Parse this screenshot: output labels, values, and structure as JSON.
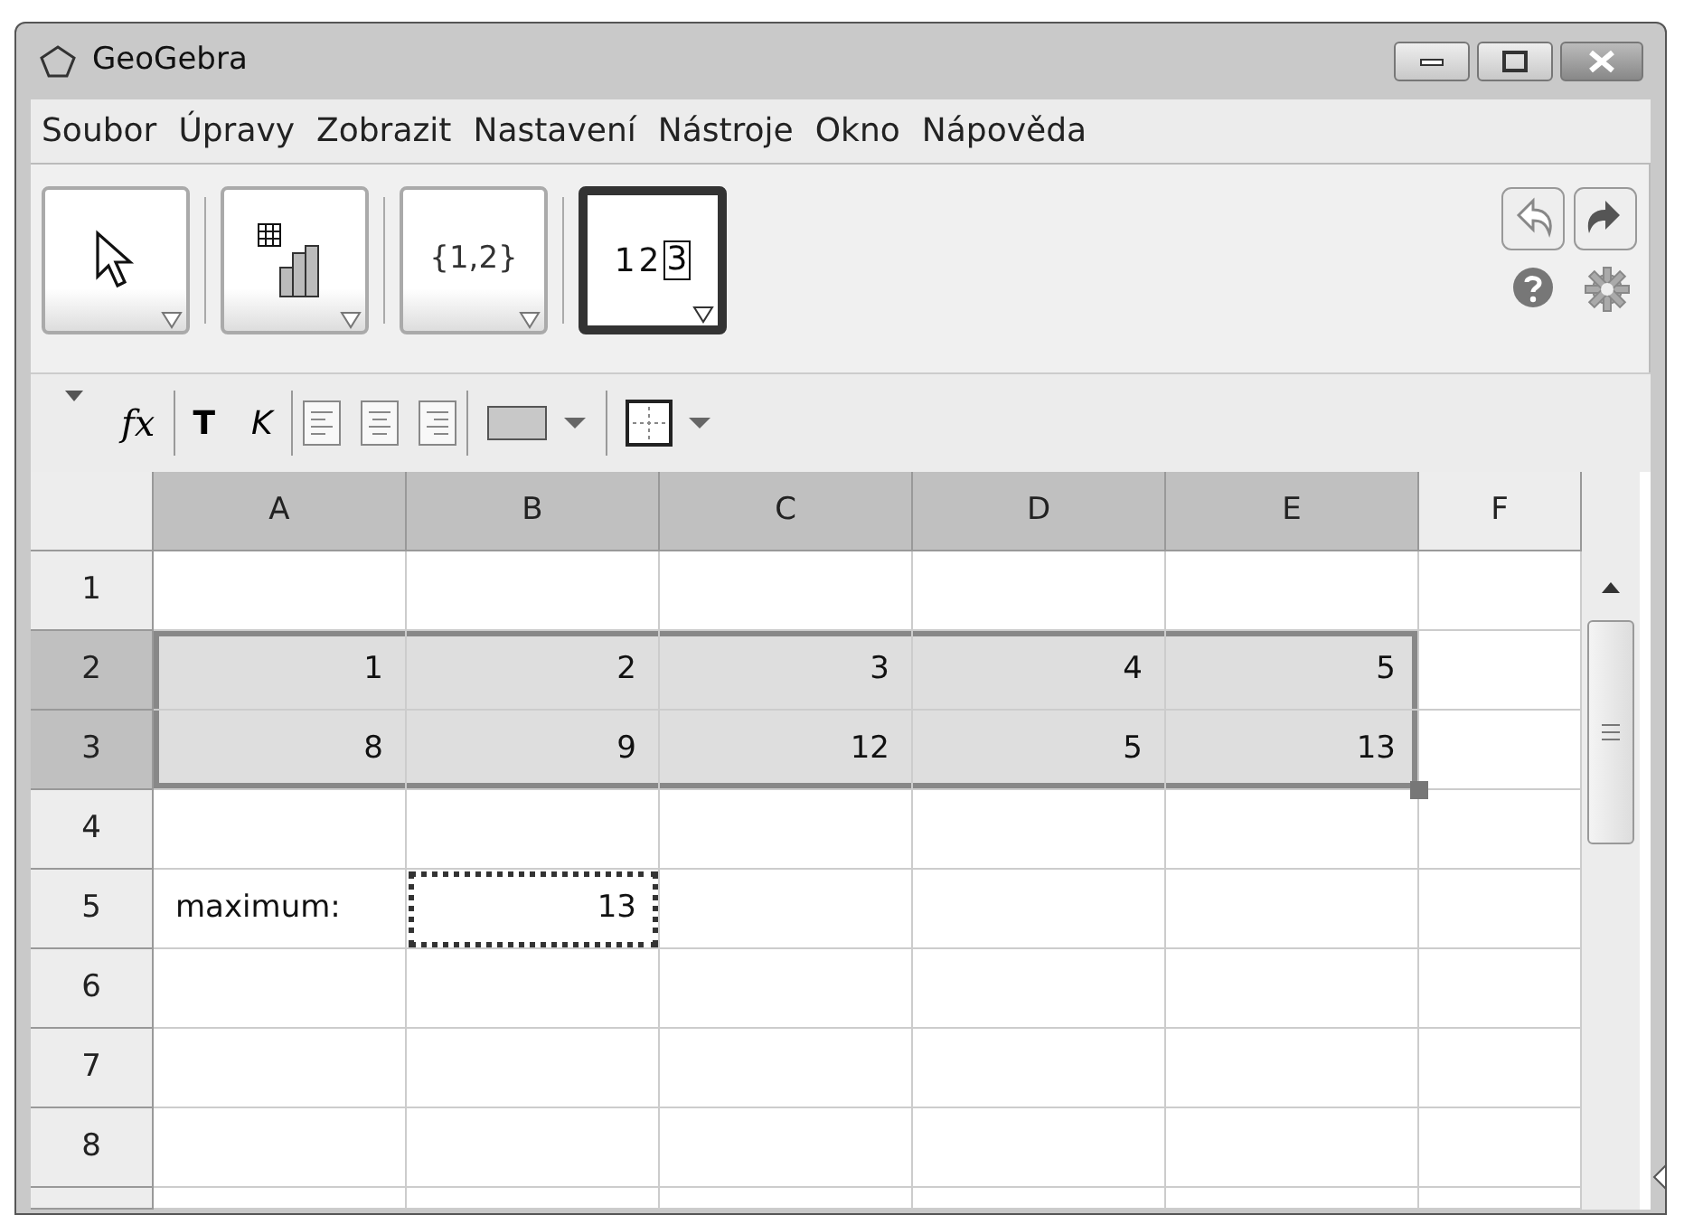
{
  "window": {
    "title": "GeoGebra"
  },
  "menu": [
    "Soubor",
    "Úpravy",
    "Zobrazit",
    "Nastavení",
    "Nástroje",
    "Okno",
    "Nápověda"
  ],
  "tools": [
    {
      "kind": "move",
      "selected": false
    },
    {
      "kind": "chart",
      "selected": false
    },
    {
      "kind": "list",
      "label": "{1,2}",
      "selected": false
    },
    {
      "kind": "table",
      "label": "12",
      "boxed_label": "3",
      "selected": true
    }
  ],
  "format_bar": [
    {
      "kind": "collapse"
    },
    {
      "kind": "formula",
      "label": "fx"
    },
    {
      "kind": "separator"
    },
    {
      "kind": "bold",
      "label": "T"
    },
    {
      "kind": "italic",
      "label": "K"
    },
    {
      "kind": "separator"
    },
    {
      "kind": "align-left"
    },
    {
      "kind": "align-center"
    },
    {
      "kind": "align-right"
    },
    {
      "kind": "separator"
    },
    {
      "kind": "fill"
    },
    {
      "kind": "separator"
    },
    {
      "kind": "border"
    }
  ],
  "columns": [
    {
      "label": "A",
      "selected": true
    },
    {
      "label": "B",
      "selected": true
    },
    {
      "label": "C",
      "selected": true
    },
    {
      "label": "D",
      "selected": true
    },
    {
      "label": "E",
      "selected": true
    },
    {
      "label": "F",
      "selected": false
    }
  ],
  "rows": [
    {
      "label": "1",
      "selected": false,
      "cells": [
        {
          "selected": false
        },
        {
          "selected": false
        },
        {
          "selected": false
        },
        {
          "selected": false
        },
        {
          "selected": false
        },
        {
          "selected": false
        }
      ]
    },
    {
      "label": "2",
      "selected": true,
      "cells": [
        {
          "text": "1",
          "selected": true
        },
        {
          "text": "2",
          "selected": true
        },
        {
          "text": "3",
          "selected": true
        },
        {
          "text": "4",
          "selected": true
        },
        {
          "text": "5",
          "selected": true
        },
        {
          "selected": false
        }
      ]
    },
    {
      "label": "3",
      "selected": true,
      "cells": [
        {
          "text": "8",
          "selected": true
        },
        {
          "text": "9",
          "selected": true
        },
        {
          "text": "12",
          "selected": true
        },
        {
          "text": "5",
          "selected": true
        },
        {
          "text": "13",
          "selected": true
        },
        {
          "selected": false
        }
      ]
    },
    {
      "label": "4",
      "selected": false,
      "cells": [
        {
          "selected": false
        },
        {
          "selected": false
        },
        {
          "selected": false
        },
        {
          "selected": false
        },
        {
          "selected": false
        },
        {
          "selected": false
        }
      ]
    },
    {
      "label": "5",
      "selected": false,
      "cells": [
        {
          "text": "maximum:",
          "kind": "text",
          "selected": false
        },
        {
          "text": "13",
          "selected": false,
          "focused": true
        },
        {
          "selected": false
        },
        {
          "selected": false
        },
        {
          "selected": false
        },
        {
          "selected": false
        }
      ]
    },
    {
      "label": "6",
      "selected": false,
      "cells": [
        {
          "selected": false
        },
        {
          "selected": false
        },
        {
          "selected": false
        },
        {
          "selected": false
        },
        {
          "selected": false
        },
        {
          "selected": false
        }
      ]
    },
    {
      "label": "7",
      "selected": false,
      "cells": [
        {
          "selected": false
        },
        {
          "selected": false
        },
        {
          "selected": false
        },
        {
          "selected": false
        },
        {
          "selected": false
        },
        {
          "selected": false
        }
      ]
    },
    {
      "label": "8",
      "selected": false,
      "cells": [
        {
          "selected": false
        },
        {
          "selected": false
        },
        {
          "selected": false
        },
        {
          "selected": false
        },
        {
          "selected": false
        },
        {
          "selected": false
        }
      ]
    }
  ]
}
